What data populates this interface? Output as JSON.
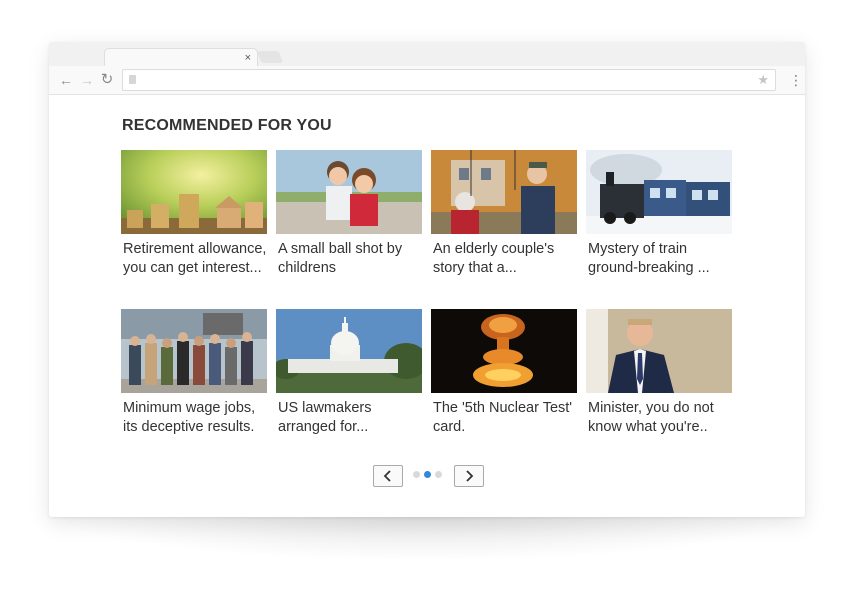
{
  "browser": {
    "tab_close_glyph": "×",
    "address_bar_value": ""
  },
  "section": {
    "heading": "RECOMMENDED FOR YOU"
  },
  "articles": [
    {
      "caption": "Retirement allowance, you can get interest...",
      "image": "coins-and-wooden-house"
    },
    {
      "caption": "A small ball shot by childrens",
      "image": "two-children-hugging"
    },
    {
      "caption": "An elderly couple's story that a...",
      "image": "elderly-couple-swing"
    },
    {
      "caption": "Mystery of train ground-breaking ...",
      "image": "steam-train-snow"
    },
    {
      "caption": "Minimum wage jobs, its deceptive results.",
      "image": "protest-crowd"
    },
    {
      "caption": "US lawmakers arranged for...",
      "image": "us-capitol-building"
    },
    {
      "caption": "The '5th Nuclear Test' card.",
      "image": "nuclear-explosion"
    },
    {
      "caption": "Minister, you do not know what you're..",
      "image": "smiling-man-in-suit"
    }
  ],
  "pagination": {
    "pages": 3,
    "current_page": 2,
    "prev_icon": "chevron-left-icon",
    "next_icon": "chevron-right-icon"
  },
  "colors": {
    "heading": "#333333",
    "active_dot": "#2f8bd9",
    "inactive_dot": "#d9d9d9"
  }
}
